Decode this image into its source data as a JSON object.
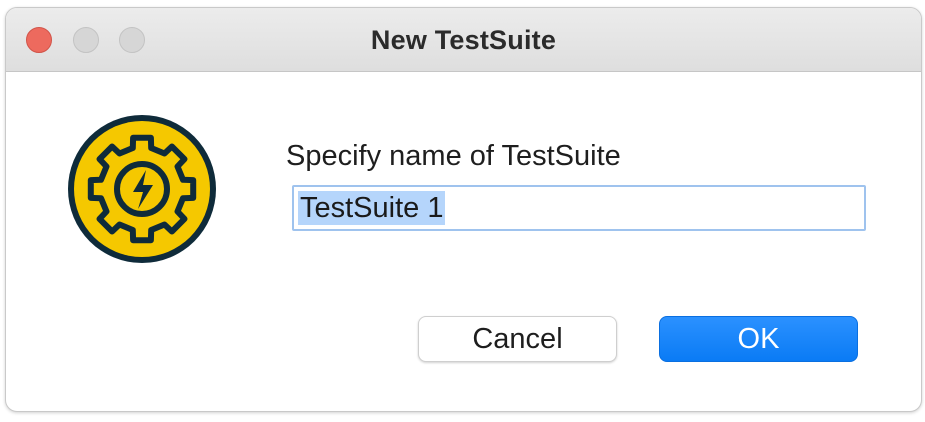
{
  "window": {
    "title": "New TestSuite",
    "traffic_lights": [
      "close",
      "minimize",
      "zoom"
    ]
  },
  "dialog": {
    "icon": "gear-lightning-icon",
    "prompt": "Specify name of TestSuite",
    "name_field": {
      "value": "TestSuite 1",
      "selected": true
    },
    "buttons": {
      "cancel_label": "Cancel",
      "ok_label": "OK"
    }
  },
  "colors": {
    "icon_yellow": "#F5C800",
    "icon_dark": "#0F2B3A",
    "ok_blue": "#0A7BF5",
    "selection": "#B5D5FB",
    "close_red": "#ED6A5E"
  }
}
